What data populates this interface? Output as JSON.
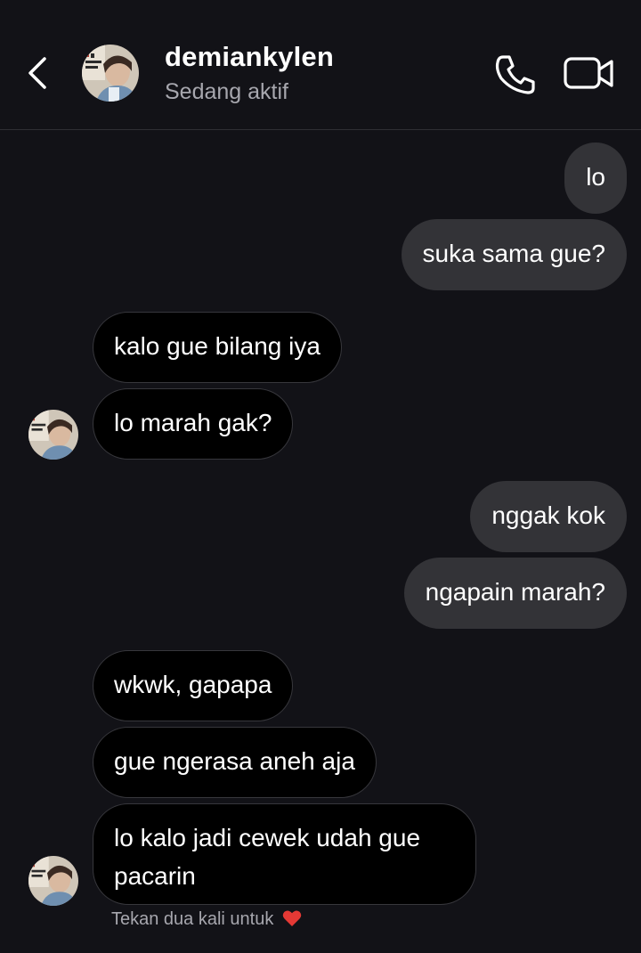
{
  "header": {
    "username": "demiankylen",
    "status": "Sedang aktif",
    "back_icon": "chevron-left-icon",
    "call_icon": "phone-icon",
    "video_icon": "video-camera-icon"
  },
  "messages": [
    {
      "from": "me",
      "text": "lo"
    },
    {
      "from": "me",
      "text": "suka sama gue?"
    },
    {
      "from": "them",
      "text": "kalo gue bilang iya"
    },
    {
      "from": "them",
      "text": "lo marah gak?"
    },
    {
      "from": "me",
      "text": "nggak kok"
    },
    {
      "from": "me",
      "text": "ngapain marah?"
    },
    {
      "from": "them",
      "text": "wkwk, gapapa"
    },
    {
      "from": "them",
      "text": "gue ngerasa aneh aja"
    },
    {
      "from": "them",
      "text": "lo kalo jadi cewek udah gue pacarin"
    }
  ],
  "hint": {
    "text": "Tekan dua kali untuk",
    "icon": "heart-icon"
  },
  "colors": {
    "background": "#121217",
    "sent_bubble": "#333337",
    "received_bubble": "#000000",
    "muted_text": "#a7a7ae",
    "heart": "#e53935"
  }
}
